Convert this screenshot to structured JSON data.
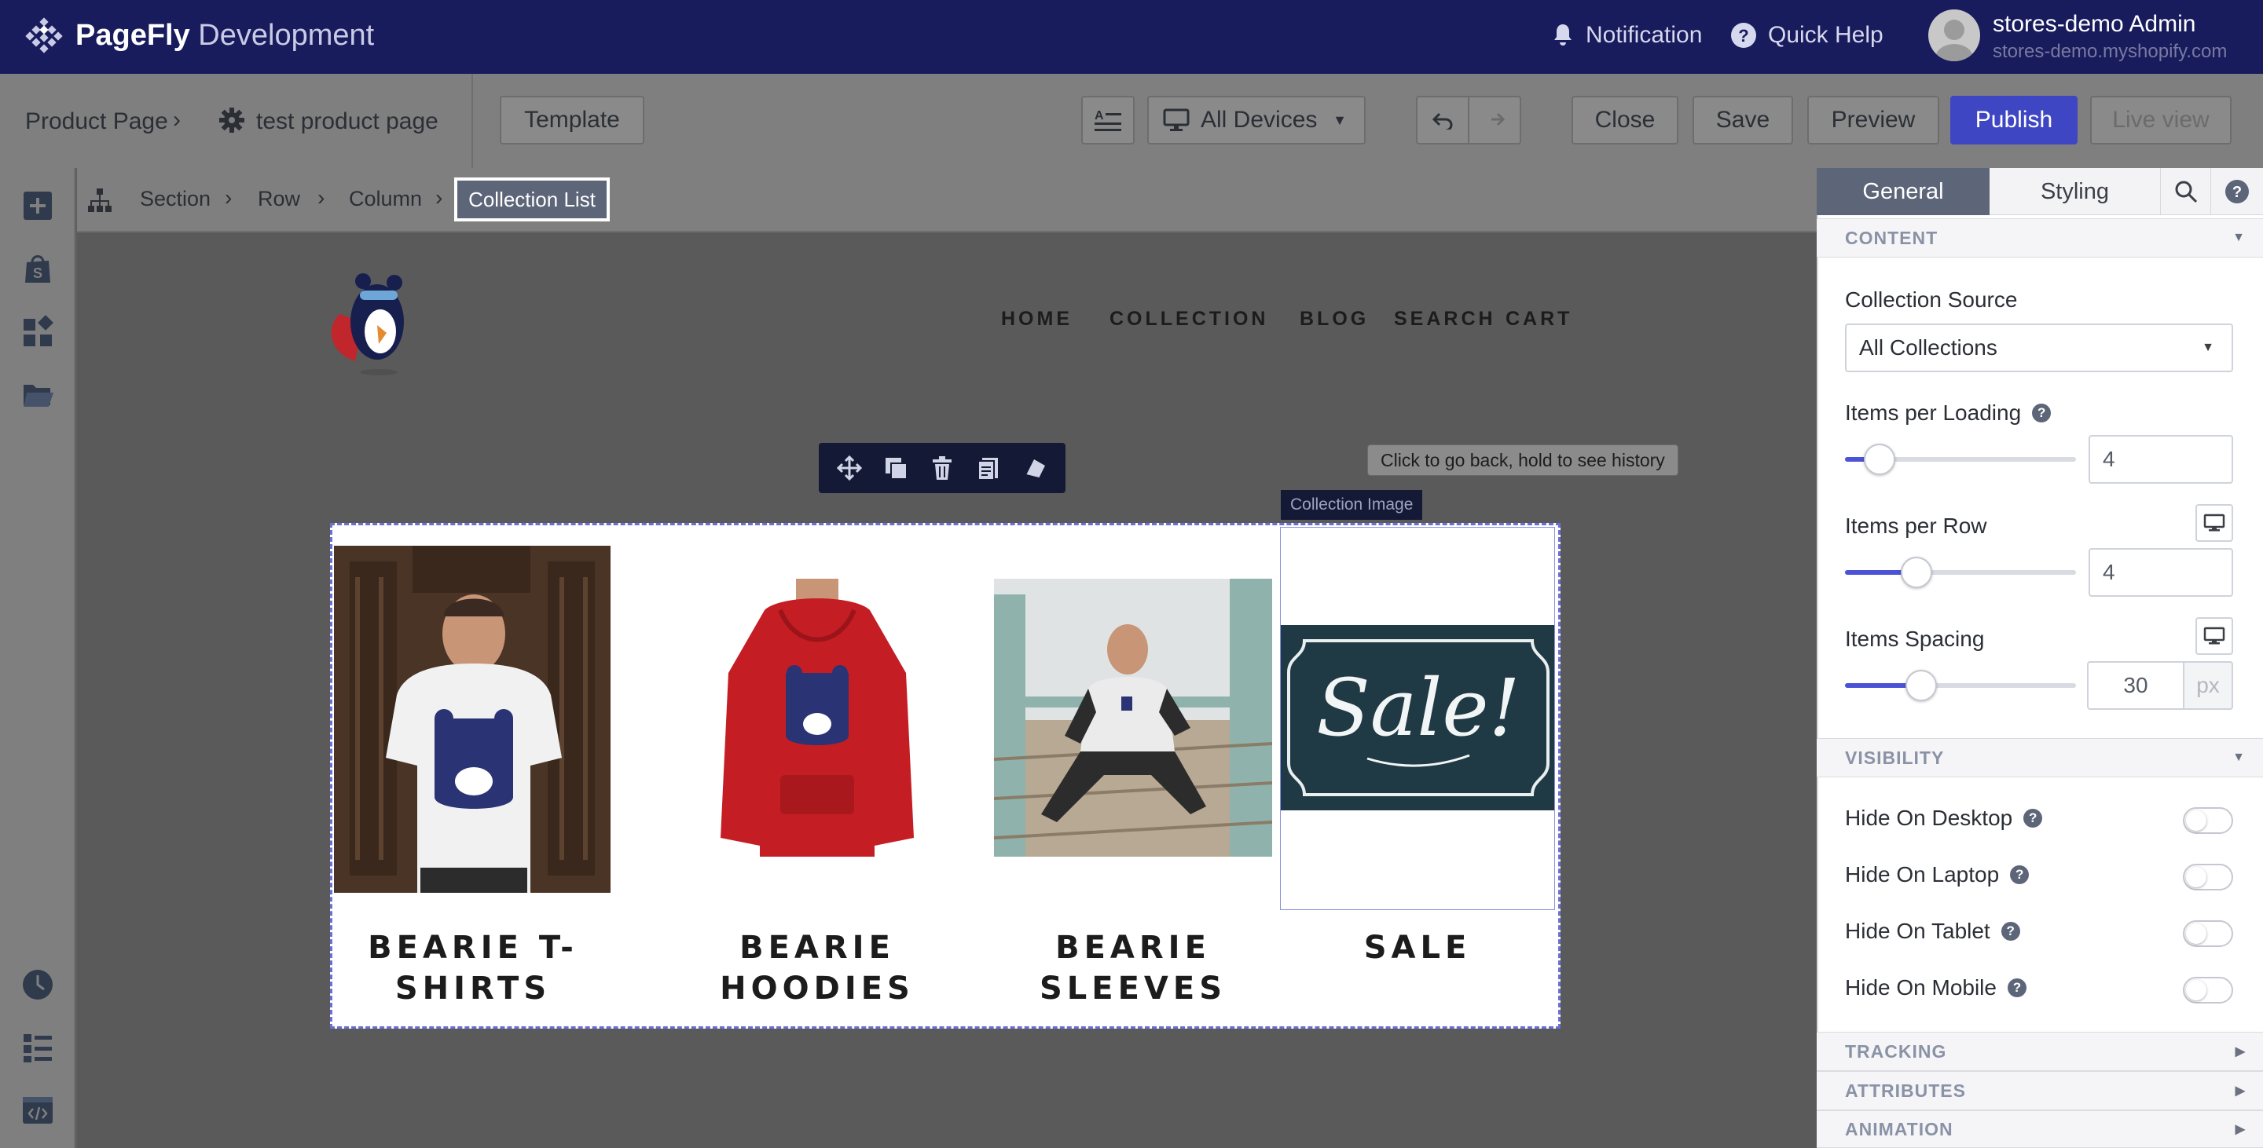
{
  "topbar": {
    "brand_bold": "PageFly",
    "brand_light": "Development",
    "notification_label": "Notification",
    "quick_help_label": "Quick Help",
    "user_name": "stores-demo Admin",
    "user_store": "stores-demo.myshopify.com"
  },
  "secondbar": {
    "breadcrumb_root": "Product Page",
    "page_name": "test product page",
    "template_label": "Template",
    "device_label": "All Devices",
    "close_label": "Close",
    "save_label": "Save",
    "preview_label": "Preview",
    "publish_label": "Publish",
    "live_view_label": "Live view"
  },
  "canvas": {
    "breadcrumb": [
      "Section",
      "Row",
      "Column"
    ],
    "breadcrumb_active": "Collection List",
    "nav": [
      "HOME",
      "COLLECTION",
      "BLOG",
      "SEARCH",
      "CART"
    ],
    "tooltip": "Click to go back, hold to see history",
    "selected_tag": "Collection Image",
    "collections": [
      {
        "title_line1": "BEARIE T-",
        "title_line2": "SHIRTS"
      },
      {
        "title_line1": "BEARIE",
        "title_line2": "HOODIES"
      },
      {
        "title_line1": "BEARIE",
        "title_line2": "SLEEVES"
      },
      {
        "title_line1": "SALE",
        "title_line2": ""
      }
    ],
    "sale_sign_text": "Sale!"
  },
  "panel": {
    "tab_general": "General",
    "tab_styling": "Styling",
    "content_heading": "CONTENT",
    "collection_source_label": "Collection Source",
    "collection_source_value": "All Collections",
    "items_per_loading_label": "Items per Loading",
    "items_per_loading_value": "4",
    "items_per_loading_fraction": 0.15,
    "items_per_row_label": "Items per Row",
    "items_per_row_value": "4",
    "items_per_row_fraction": 0.31,
    "items_spacing_label": "Items Spacing",
    "items_spacing_value": "30",
    "items_spacing_fraction": 0.33,
    "items_spacing_unit": "px",
    "visibility_heading": "VISIBILITY",
    "hide_desktop": "Hide On Desktop",
    "hide_laptop": "Hide On Laptop",
    "hide_tablet": "Hide On Tablet",
    "hide_mobile": "Hide On Mobile",
    "tracking_heading": "TRACKING",
    "attributes_heading": "ATTRIBUTES",
    "animation_heading": "ANIMATION"
  },
  "colors": {
    "topbar": "#181b5c",
    "publish": "#3f46c4",
    "accent": "#4b52d6",
    "active_tab": "#5d6578"
  }
}
